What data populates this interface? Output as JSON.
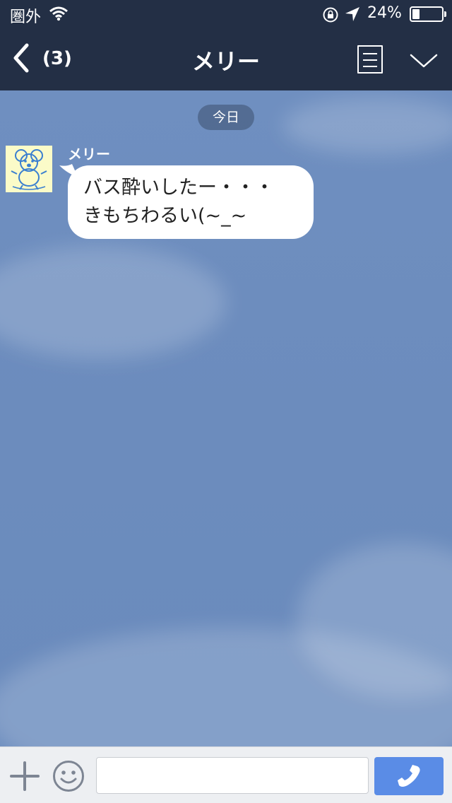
{
  "status_bar": {
    "carrier": "圏外",
    "battery_percent": "24%",
    "battery_level": 0.24
  },
  "nav": {
    "unread_count": "(3)",
    "title": "メリー"
  },
  "chat": {
    "date_label": "今日",
    "messages": [
      {
        "sender": "メリー",
        "text": "バス酔いしたー・・・\nきもちわるい(~_~"
      }
    ]
  },
  "input_bar": {
    "text_value": "",
    "placeholder": ""
  },
  "icons": {
    "back": "chevron-left-icon",
    "notes": "note-icon",
    "menu": "chevron-down-icon",
    "add": "plus-icon",
    "emoji": "smiley-icon",
    "call": "phone-icon"
  },
  "colors": {
    "topbar": "#232f45",
    "chat_background": "#6e8fbd",
    "call_button": "#5a8ce6"
  }
}
